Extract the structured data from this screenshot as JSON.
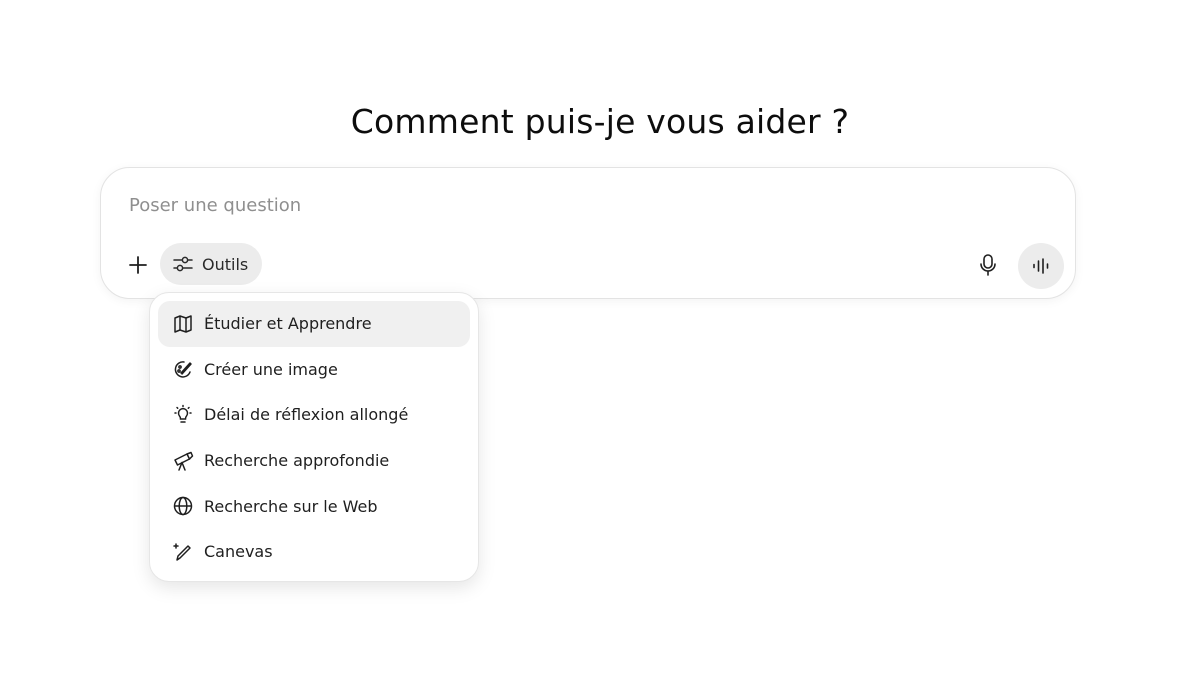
{
  "heading": "Comment puis-je vous aider ?",
  "composer": {
    "placeholder": "Poser une question",
    "value": "",
    "add_icon": "plus-icon",
    "tools_label": "Outils",
    "tools_icon": "sliders-icon",
    "mic_icon": "microphone-icon",
    "voice_icon": "voice-waveform-icon"
  },
  "tools_menu": {
    "items": [
      {
        "label": "Étudier et Apprendre",
        "icon": "book-open-icon",
        "active": true
      },
      {
        "label": "Créer une image",
        "icon": "palette-icon",
        "active": false
      },
      {
        "label": "Délai de réflexion allongé",
        "icon": "lightbulb-icon",
        "active": false
      },
      {
        "label": "Recherche approfondie",
        "icon": "telescope-icon",
        "active": false
      },
      {
        "label": "Recherche sur le Web",
        "icon": "globe-icon",
        "active": false
      },
      {
        "label": "Canevas",
        "icon": "pencil-sparkle-icon",
        "active": false
      }
    ]
  },
  "colors": {
    "pill_background": "#ececec",
    "menu_hover": "#f0f0f0",
    "placeholder": "#8f8f8f",
    "text": "#0d0d0d"
  }
}
